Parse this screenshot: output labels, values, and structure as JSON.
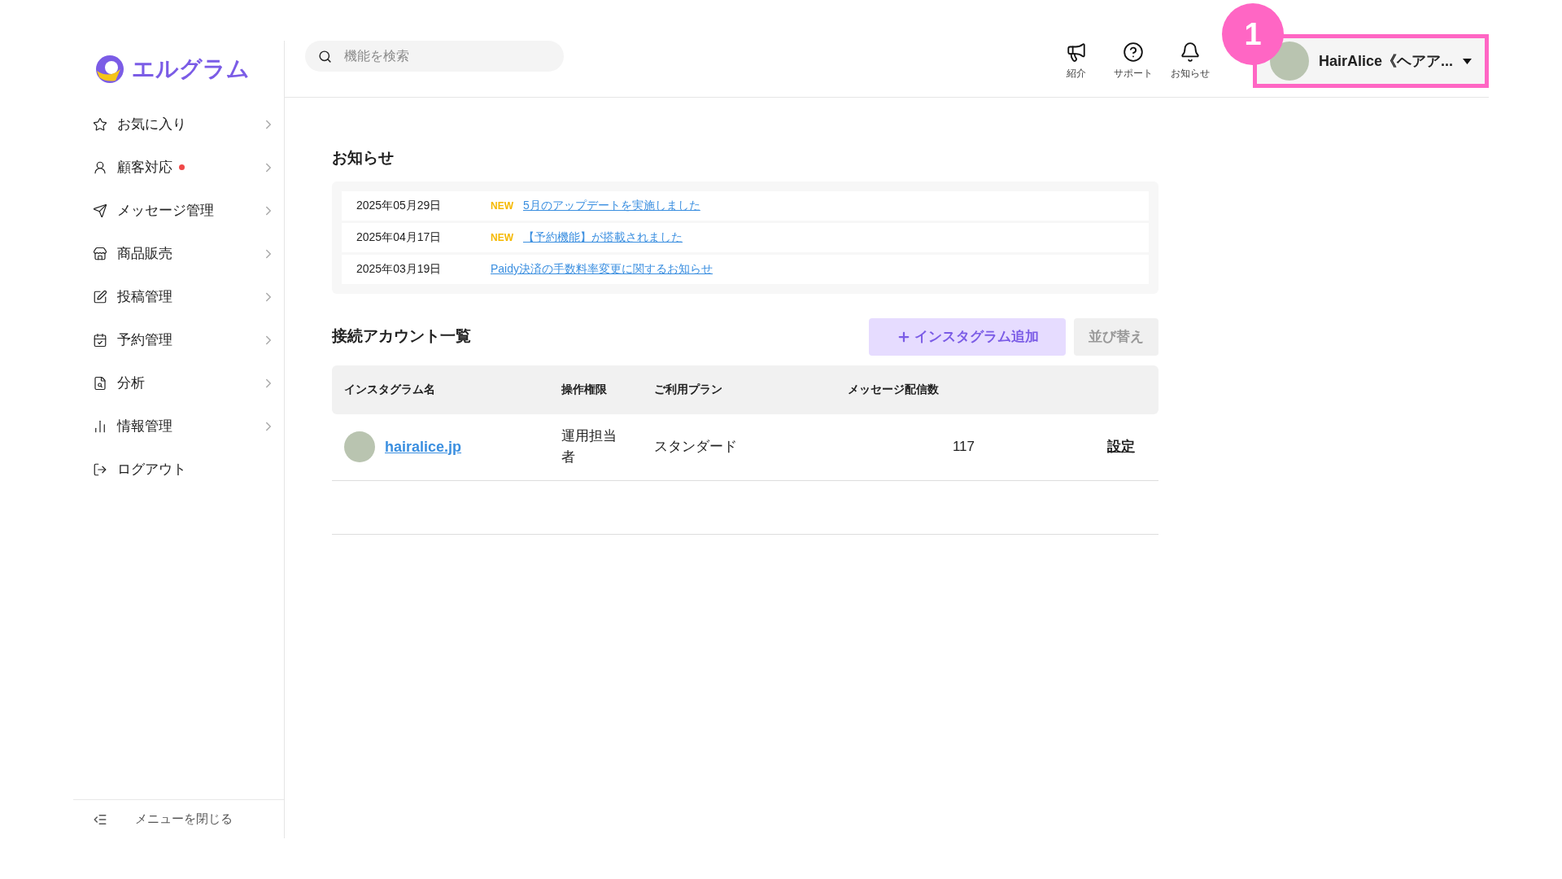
{
  "sidebar": {
    "logo": "エルグラム",
    "items": [
      {
        "label": "お気に入り",
        "dot": false,
        "has_submenu": true
      },
      {
        "label": "顧客対応",
        "dot": true,
        "has_submenu": true
      },
      {
        "label": "メッセージ管理",
        "dot": false,
        "has_submenu": true
      },
      {
        "label": "商品販売",
        "dot": false,
        "has_submenu": true
      },
      {
        "label": "投稿管理",
        "dot": false,
        "has_submenu": true
      },
      {
        "label": "予約管理",
        "dot": false,
        "has_submenu": true
      },
      {
        "label": "分析",
        "dot": false,
        "has_submenu": true
      },
      {
        "label": "情報管理",
        "dot": false,
        "has_submenu": true
      },
      {
        "label": "ログアウト",
        "dot": false,
        "has_submenu": false
      }
    ],
    "collapse": "メニューを閉じる"
  },
  "header": {
    "search": {
      "placeholder": "機能を検索"
    },
    "actions": [
      {
        "label": "紹介"
      },
      {
        "label": "サポート"
      },
      {
        "label": "お知らせ"
      }
    ],
    "account": {
      "name": "HairAlice《ヘアア..."
    },
    "annotation": "1"
  },
  "notices": {
    "title": "お知らせ",
    "items": [
      {
        "date": "2025年05月29日",
        "new": true,
        "new_label": "NEW",
        "text": "5月のアップデートを実施しました"
      },
      {
        "date": "2025年04月17日",
        "new": true,
        "new_label": "NEW",
        "text": "【予約機能】が搭載されました"
      },
      {
        "date": "2025年03月19日",
        "new": false,
        "text": "Paidy決済の手数料率変更に関するお知らせ"
      }
    ]
  },
  "accounts": {
    "title": "接続アカウント一覧",
    "add_button": "インスタグラム追加",
    "sort_button": "並び替え",
    "columns": [
      "インスタグラム名",
      "操作権限",
      "ご利用プラン",
      "メッセージ配信数"
    ],
    "rows": [
      {
        "name": "hairalice.jp",
        "role": "運用担当者",
        "plan": "スタンダード",
        "count": "117",
        "action": "設定"
      }
    ]
  }
}
